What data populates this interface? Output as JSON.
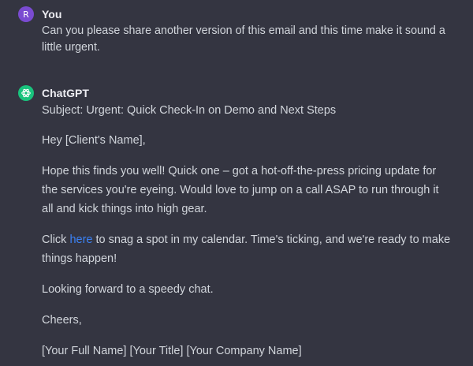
{
  "user_message": {
    "avatar_letter": "R",
    "author": "You",
    "text": "Can you please share another version of this email and this time make it sound a little urgent."
  },
  "assistant_message": {
    "author": "ChatGPT",
    "avatar_icon": "openai-logo-icon",
    "subject": "Subject: Urgent: Quick Check-In on Demo and Next Steps",
    "greeting": "Hey [Client's Name],",
    "paragraph1": "Hope this finds you well! Quick one – got a hot-off-the-press pricing update for the services you're eyeing. Would love to jump on a call ASAP to run through it all and kick things into high gear.",
    "paragraph2_before_link": "Click ",
    "paragraph2_link": "here",
    "paragraph2_after_link": " to snag a spot in my calendar. Time's ticking, and we're ready to make things happen!",
    "closing_line": "Looking forward to a speedy chat.",
    "signoff": "Cheers,",
    "signature": "[Your Full Name] [Your Title] [Your Company Name]"
  },
  "colors": {
    "background": "#343541",
    "user_avatar": "#7a4bd1",
    "gpt_avatar": "#19c37d",
    "link": "#3b82f6"
  }
}
